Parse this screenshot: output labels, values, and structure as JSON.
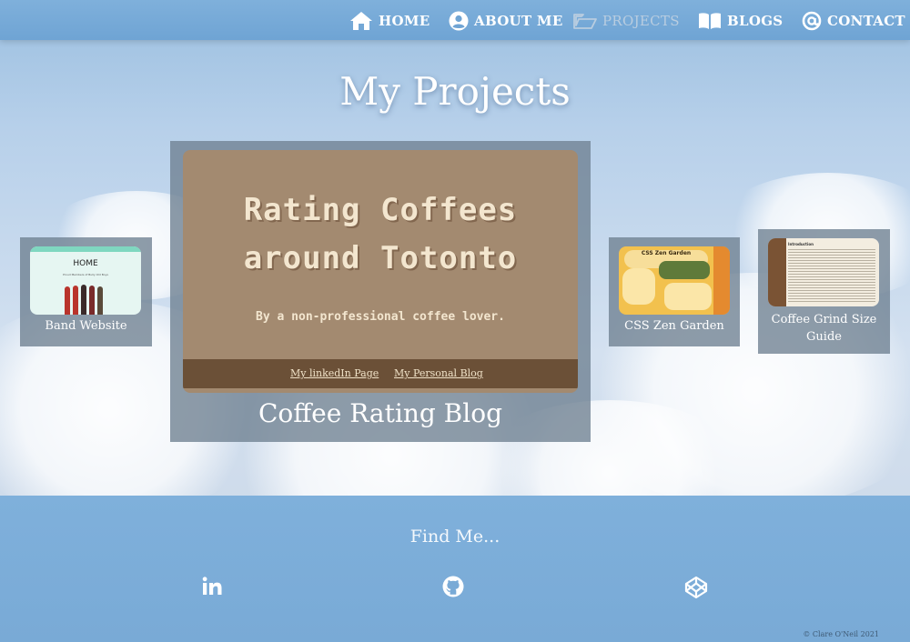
{
  "nav": {
    "items": [
      {
        "label": "HOME",
        "icon": "home-icon"
      },
      {
        "label": "ABOUT ME",
        "icon": "user-icon"
      },
      {
        "label": "PROJECTS",
        "icon": "folder-open-icon",
        "active": true
      },
      {
        "label": "BLOGS",
        "icon": "book-icon"
      },
      {
        "label": "CONTACT",
        "icon": "at-icon"
      }
    ]
  },
  "page": {
    "title": "My Projects"
  },
  "projects": {
    "band": {
      "label": "Band Website",
      "thumb_heading": "HOME",
      "thumb_caption": "Proud Members of Bully Old Boys"
    },
    "featured": {
      "label": "Coffee Rating Blog",
      "thumb_line1": "Rating Coffees",
      "thumb_line2": "around Totonto",
      "thumb_sub": "By a non-professional coffee lover.",
      "link1": "My linkedIn Page",
      "link2": "My Personal Blog"
    },
    "zen": {
      "label": "CSS Zen Garden",
      "thumb_heading": "CSS Zen Garden"
    },
    "grind": {
      "label": "Coffee Grind Size Guide",
      "thumb_heading": "Introduction"
    }
  },
  "footer": {
    "find_me": "Find Me...",
    "social": [
      "linkedin-icon",
      "github-icon",
      "codepen-icon"
    ],
    "copyright": "© Clare O'Neil 2021"
  },
  "colors": {
    "nav_bg": "#7fb0db",
    "card_bg": "#6e8091",
    "featured_thumb_bg": "#a38a70",
    "featured_footer_bg": "#6b5037"
  }
}
